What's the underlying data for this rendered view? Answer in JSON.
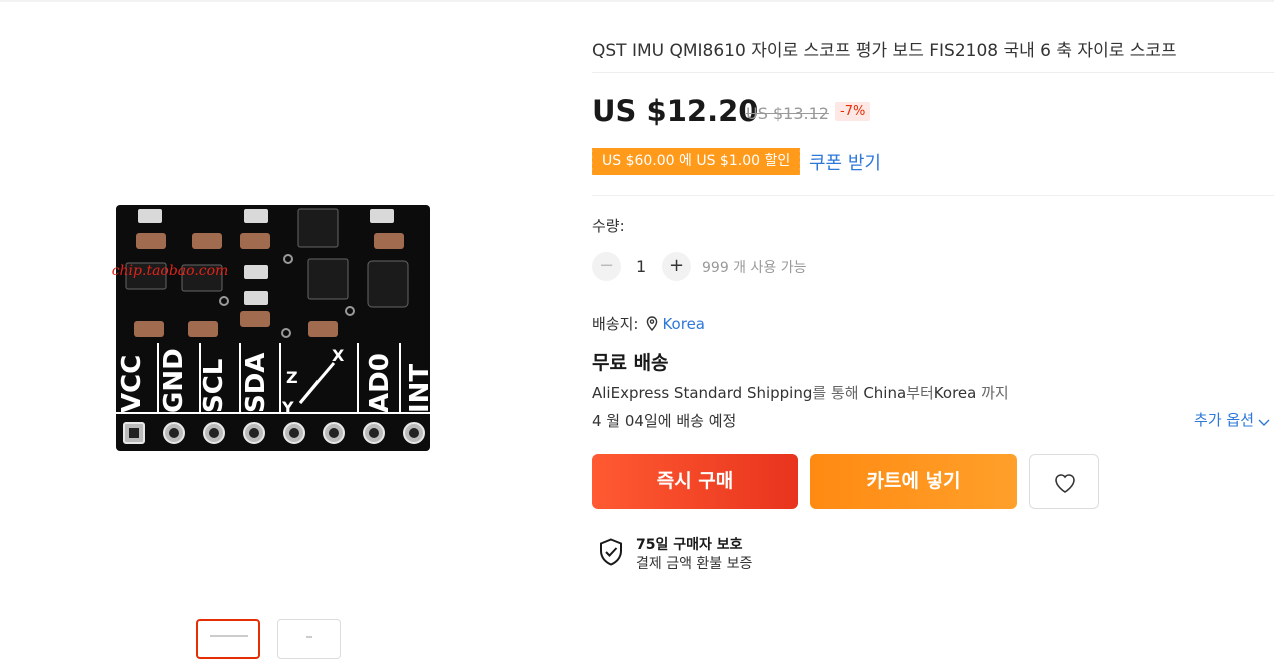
{
  "product": {
    "title": "QST IMU QMI8610 자이로 스코프 평가 보드 FIS2108 국내 6 축 자이로 스코프",
    "image_watermark": "xyxchip.taobao.com",
    "board_labels": [
      "VCC",
      "GND",
      "SCL",
      "SDA",
      "AD0",
      "INT"
    ],
    "axis_labels": [
      "Y",
      "Z",
      "X"
    ]
  },
  "pricing": {
    "price": "US $12.20",
    "original_price": "US $13.12",
    "discount": "-7%",
    "coupon_text": "US $60.00 에 US $1.00 할인",
    "coupon_link": "쿠폰 받기"
  },
  "quantity": {
    "label": "수량:",
    "minus": "−",
    "value": "1",
    "plus": "+",
    "available": "999 개 사용 가능"
  },
  "shipping": {
    "ship_to_label": "배송지:",
    "country": "Korea",
    "free_label": "무료 배송",
    "via_prefix": "AliExpress Standard Shipping",
    "via_mid": "를 통해 ",
    "from": "China",
    "from_suffix": "부터",
    "to": "Korea",
    "to_suffix": " 까지",
    "eta_date": "4 월 04일",
    "eta_suffix": "에 배송 예정",
    "more_options": "추가 옵션"
  },
  "actions": {
    "buy_now": "즉시 구매",
    "add_to_cart": "카트에 넣기"
  },
  "protection": {
    "title": "75일 구매자 보호",
    "subtitle": "결제 금액 환불 보증"
  },
  "icons": {
    "wishlist": "heart-icon",
    "location": "location-pin-icon",
    "protection": "shield-check-icon",
    "expand": "chevron-down-icon"
  },
  "colors": {
    "buy_now": "#e8341d",
    "add_to_cart": "#ff9a1a",
    "coupon": "#ff9a1a",
    "link": "#2e78d9",
    "discount": "#e62e04"
  }
}
